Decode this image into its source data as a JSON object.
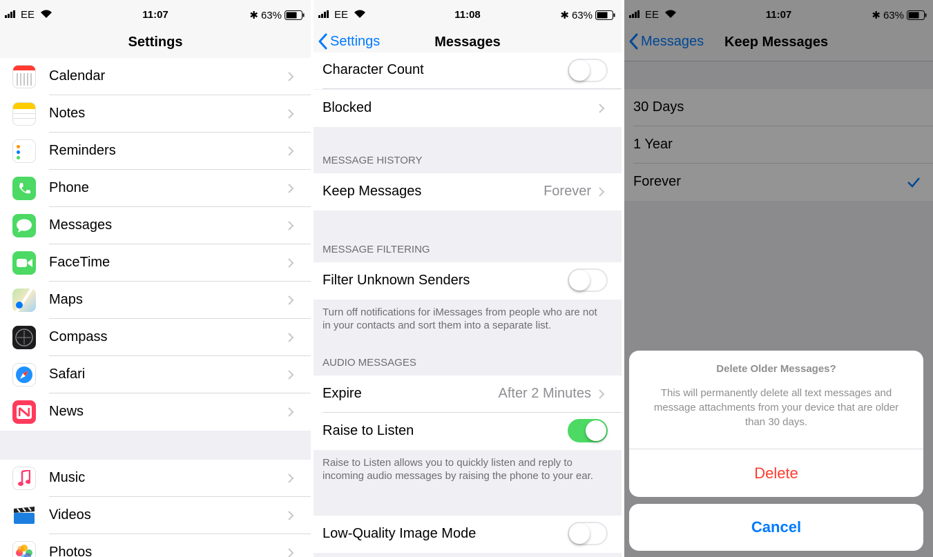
{
  "panel1": {
    "status": {
      "carrier": "EE",
      "time": "11:07",
      "battery": "63%"
    },
    "title": "Settings",
    "group1": [
      {
        "label": "Calendar",
        "icon": "calendar-icon"
      },
      {
        "label": "Notes",
        "icon": "notes-icon"
      },
      {
        "label": "Reminders",
        "icon": "reminders-icon"
      },
      {
        "label": "Phone",
        "icon": "phone-icon"
      },
      {
        "label": "Messages",
        "icon": "messages-icon"
      },
      {
        "label": "FaceTime",
        "icon": "facetime-icon"
      },
      {
        "label": "Maps",
        "icon": "maps-icon"
      },
      {
        "label": "Compass",
        "icon": "compass-icon"
      },
      {
        "label": "Safari",
        "icon": "safari-icon"
      },
      {
        "label": "News",
        "icon": "news-icon"
      }
    ],
    "group2": [
      {
        "label": "Music",
        "icon": "music-icon"
      },
      {
        "label": "Videos",
        "icon": "videos-icon"
      },
      {
        "label": "Photos",
        "icon": "photos-icon"
      }
    ]
  },
  "panel2": {
    "status": {
      "carrier": "EE",
      "time": "11:08",
      "battery": "63%"
    },
    "back_label": "Settings",
    "title": "Messages",
    "character_count": "Character Count",
    "blocked": "Blocked",
    "history_header": "MESSAGE HISTORY",
    "keep_messages": {
      "label": "Keep Messages",
      "value": "Forever"
    },
    "filtering_header": "MESSAGE FILTERING",
    "filter_unknown": "Filter Unknown Senders",
    "filter_footnote": "Turn off notifications for iMessages from people who are not in your contacts and sort them into a separate list.",
    "audio_header": "AUDIO MESSAGES",
    "expire": {
      "label": "Expire",
      "value": "After 2 Minutes"
    },
    "raise_to_listen": "Raise to Listen",
    "raise_footnote": "Raise to Listen allows you to quickly listen and reply to incoming audio messages by raising the phone to your ear.",
    "low_quality": "Low-Quality Image Mode",
    "toggles": {
      "character_count": false,
      "filter_unknown": false,
      "raise_to_listen": true,
      "low_quality": false
    }
  },
  "panel3": {
    "status": {
      "carrier": "EE",
      "time": "11:07",
      "battery": "63%"
    },
    "back_label": "Messages",
    "title": "Keep Messages",
    "options": [
      "30 Days",
      "1 Year",
      "Forever"
    ],
    "selected": "Forever",
    "alert": {
      "title": "Delete Older Messages?",
      "message": "This will permanently delete all text messages and message attachments from your device that are older than 30 days.",
      "delete": "Delete",
      "cancel": "Cancel"
    }
  },
  "colors": {
    "ios_blue": "#007aff",
    "destructive_red": "#ff3b30",
    "toggle_on": "#4cd964",
    "group_bg": "#efeff4"
  }
}
